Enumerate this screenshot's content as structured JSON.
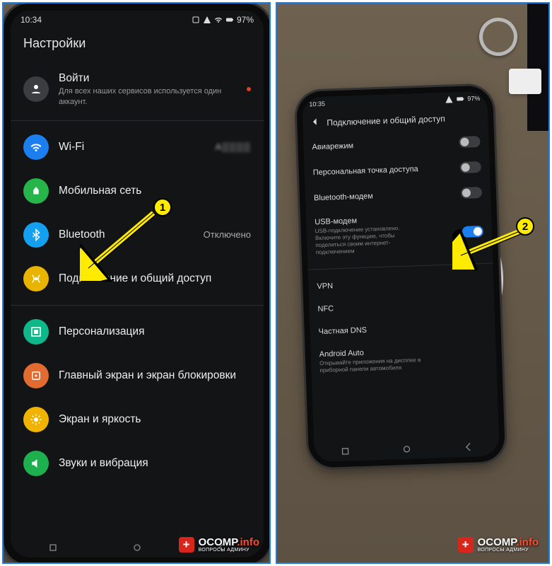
{
  "left": {
    "status": {
      "time": "10:34",
      "battery": "97%"
    },
    "title": "Настройки",
    "signin": {
      "label": "Войти",
      "sub": "Для всех наших сервисов используется один аккаунт."
    },
    "items": [
      {
        "icon": "wifi",
        "color": "ic-blue",
        "label": "Wi-Fi",
        "value": "A▒▒▒▒"
      },
      {
        "icon": "cell",
        "color": "ic-green",
        "label": "Мобильная сеть",
        "value": ""
      },
      {
        "icon": "bt",
        "color": "ic-bt",
        "label": "Bluetooth",
        "value": "Отключено"
      },
      {
        "icon": "teth",
        "color": "ic-yellow",
        "label": "Подключение и общий доступ",
        "value": ""
      }
    ],
    "items2": [
      {
        "icon": "pers",
        "color": "ic-teal",
        "label": "Персонализация"
      },
      {
        "icon": "home",
        "color": "ic-orange",
        "label": "Главный экран и экран блокировки"
      },
      {
        "icon": "sun",
        "color": "ic-yellow2",
        "label": "Экран и яркость"
      },
      {
        "icon": "sound",
        "color": "ic-green2",
        "label": "Звуки и вибрация"
      }
    ]
  },
  "right": {
    "status": {
      "time": "10:35",
      "battery": "97%"
    },
    "header": "Подключение и общий доступ",
    "rows": [
      {
        "label": "Авиарежим",
        "on": false
      },
      {
        "label": "Персональная точка доступа",
        "on": false
      },
      {
        "label": "Bluetooth-модем",
        "on": false
      },
      {
        "label": "USB-модем",
        "sub": "USB-подключение установлено. Включите эту функцию, чтобы поделиться своим интернет-подключением",
        "on": true
      }
    ],
    "rows2": [
      {
        "label": "VPN"
      },
      {
        "label": "NFC"
      },
      {
        "label": "Частная DNS"
      },
      {
        "label": "Android Auto",
        "sub": "Открывайте приложения на дисплее в приборной панели автомобиля"
      }
    ]
  },
  "markers": {
    "m1": "1",
    "m2": "2"
  },
  "watermark": {
    "brand": "OCOMP",
    "tld": ".info",
    "sub": "ВОПРОСЫ АДМИНУ"
  }
}
